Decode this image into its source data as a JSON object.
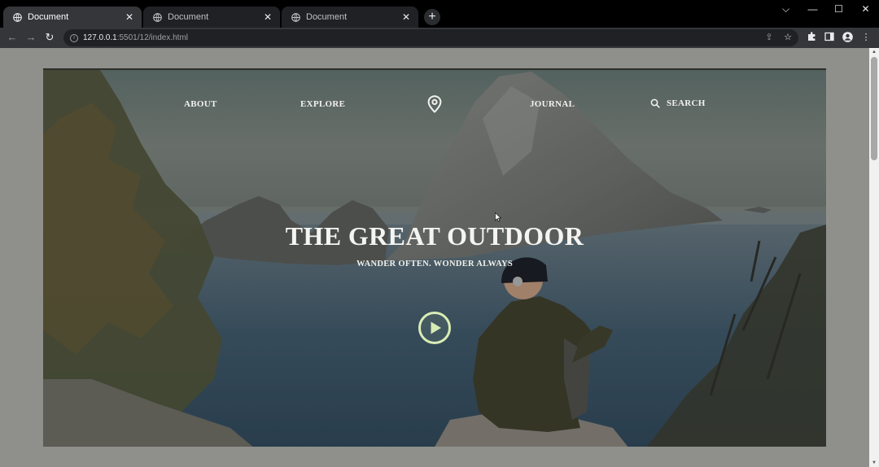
{
  "browser": {
    "tabs": [
      {
        "title": "Document",
        "active": true
      },
      {
        "title": "Document",
        "active": false
      },
      {
        "title": "Document",
        "active": false
      }
    ],
    "new_tab_label": "+",
    "window_controls": {
      "tab_search": "⌵",
      "minimize": "—",
      "maximize": "☐",
      "close": "✕"
    },
    "url_host": "127.0.0.1",
    "url_path": ":5501/12/index.html"
  },
  "site": {
    "nav": {
      "about": "ABOUT",
      "explore": "EXPLORE",
      "journal": "JOURNAL",
      "search": "SEARCH"
    },
    "hero": {
      "title": "THE GREAT OUTDOOR",
      "subtitle": "WANDER OFTEN. WONDER ALWAYS"
    }
  },
  "colors": {
    "play_accent": "#d8edb5",
    "nav_text": "#f2f2ef",
    "page_background": "#8f908c"
  },
  "icons": {
    "tab": "globe-icon",
    "nav_center": "location-pin-icon",
    "search": "search-icon",
    "play": "play-icon"
  }
}
